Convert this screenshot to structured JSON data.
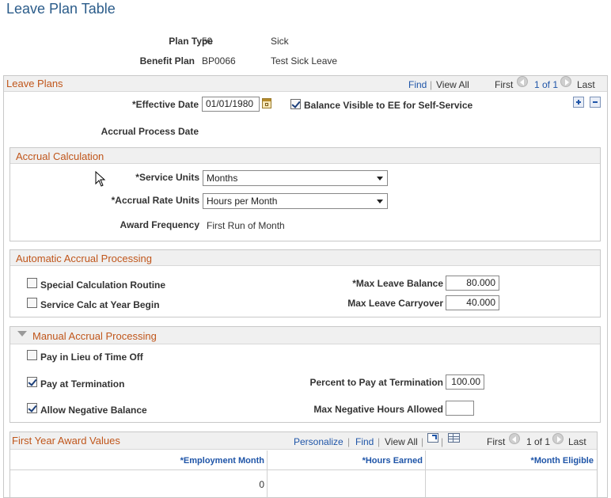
{
  "page_title": "Leave Plan Table",
  "plan_type": {
    "label": "Plan Type",
    "code": "50",
    "description": "Sick"
  },
  "benefit_plan": {
    "label": "Benefit Plan",
    "code": "BP0066",
    "description": "Test Sick Leave"
  },
  "leave_plans": {
    "title": "Leave Plans",
    "find": "Find",
    "separator": "|",
    "view_all": "View All",
    "first": "First",
    "page_info": "1 of 1",
    "last": "Last",
    "effective_date_label": "*Effective Date",
    "effective_date_value": "01/01/1980",
    "balance_visible_label": "Balance Visible to EE for Self-Service",
    "balance_visible_checked": true,
    "accrual_process_date_label": "Accrual Process Date"
  },
  "accrual_calculation": {
    "title": "Accrual Calculation",
    "service_units_label": "*Service Units",
    "service_units_value": "Months",
    "accrual_rate_units_label": "*Accrual Rate Units",
    "accrual_rate_units_value": "Hours per Month",
    "award_frequency_label": "Award Frequency",
    "award_frequency_value": "First Run of Month"
  },
  "automatic_accrual": {
    "title": "Automatic Accrual Processing",
    "special_calc_label": "Special Calculation Routine",
    "special_calc_checked": false,
    "service_calc_label": "Service Calc at Year Begin",
    "service_calc_checked": false,
    "max_leave_balance_label": "*Max Leave Balance",
    "max_leave_balance_value": "80.000",
    "max_leave_carryover_label": "Max Leave Carryover",
    "max_leave_carryover_value": "40.000"
  },
  "manual_accrual": {
    "title": "Manual Accrual Processing",
    "pay_in_lieu_label": "Pay in Lieu of Time Off",
    "pay_in_lieu_checked": false,
    "pay_at_termination_label": "Pay at Termination",
    "pay_at_termination_checked": true,
    "percent_to_pay_label": "Percent to Pay at Termination",
    "percent_to_pay_value": "100.00",
    "allow_negative_label": "Allow Negative Balance",
    "allow_negative_checked": true,
    "max_negative_hours_label": "Max Negative Hours Allowed",
    "max_negative_hours_value": ""
  },
  "first_year_award": {
    "title": "First Year Award Values",
    "personalize": "Personalize",
    "find": "Find",
    "view_all": "View All",
    "first": "First",
    "page_info": "1 of 1",
    "last": "Last",
    "columns": [
      "*Employment Month",
      "*Hours Earned",
      "*Month Eligible"
    ],
    "rows": [
      {
        "employment_month": "0",
        "hours_earned": "",
        "month_eligible": ""
      }
    ]
  }
}
